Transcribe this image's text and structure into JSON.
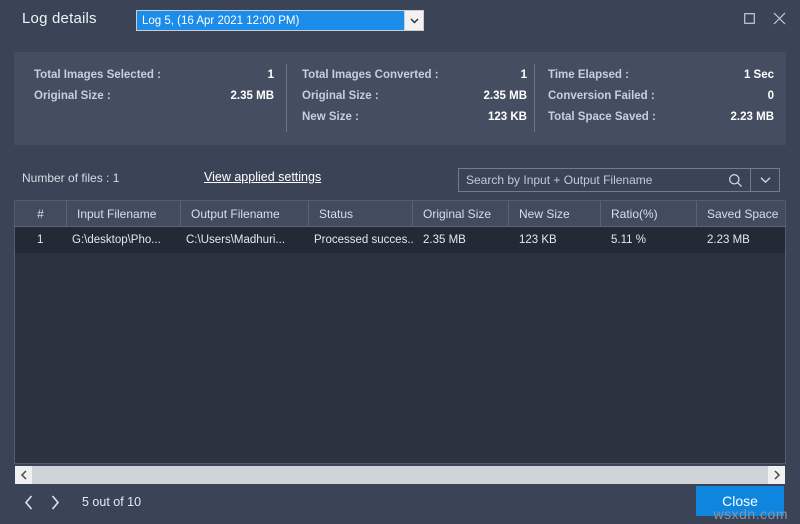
{
  "window": {
    "title": "Log details",
    "controls": {
      "maximize": "maximize-icon",
      "close": "close-icon"
    }
  },
  "log_selector": {
    "selected": "Log 5, (16 Apr 2021 12:00 PM)",
    "arrow_icon": "chevron-down-icon"
  },
  "summary": {
    "columns": [
      {
        "rows": [
          {
            "label": "Total Images Selected :",
            "value": "1"
          },
          {
            "label": "Original Size :",
            "value": "2.35 MB"
          }
        ]
      },
      {
        "rows": [
          {
            "label": "Total Images Converted :",
            "value": "1"
          },
          {
            "label": "Original Size :",
            "value": "2.35 MB"
          },
          {
            "label": "New Size :",
            "value": "123 KB"
          }
        ]
      },
      {
        "rows": [
          {
            "label": "Time Elapsed :",
            "value": "1 Sec"
          },
          {
            "label": "Conversion Failed :",
            "value": "0"
          },
          {
            "label": "Total Space Saved :",
            "value": "2.23 MB"
          }
        ]
      }
    ]
  },
  "toolbar": {
    "files_count": "Number of files : 1",
    "view_settings_link": "View applied settings",
    "search": {
      "placeholder": "Search by Input + Output Filename",
      "value": "",
      "search_icon": "search-icon",
      "caret_icon": "chevron-down-icon"
    }
  },
  "table": {
    "headers": [
      "#",
      "Input Filename",
      "Output Filename",
      "Status",
      "Original Size",
      "New Size",
      "Ratio(%)",
      "Saved Space"
    ],
    "rows": [
      [
        "1",
        "G:\\desktop\\Pho...",
        "C:\\Users\\Madhuri...",
        "Processed succes...",
        "2.35 MB",
        "123 KB",
        "5.11 %",
        "2.23 MB"
      ]
    ]
  },
  "scrollbar": {
    "left_icon": "chevron-left-icon",
    "right_icon": "chevron-right-icon"
  },
  "footer": {
    "prev_icon": "chevron-left-icon",
    "next_icon": "chevron-right-icon",
    "page_text": "5 out of 10",
    "close_label": "Close"
  },
  "watermark": {
    "text": "wsxdn.com"
  },
  "colors": {
    "window_bg": "#3a4456",
    "panel_bg": "#444e60",
    "table_bg": "#2b3341",
    "header_bg": "#424c5e",
    "row_bg": "#222a36",
    "accent": "#0e86e0",
    "combo_blue": "#1b8cea"
  }
}
